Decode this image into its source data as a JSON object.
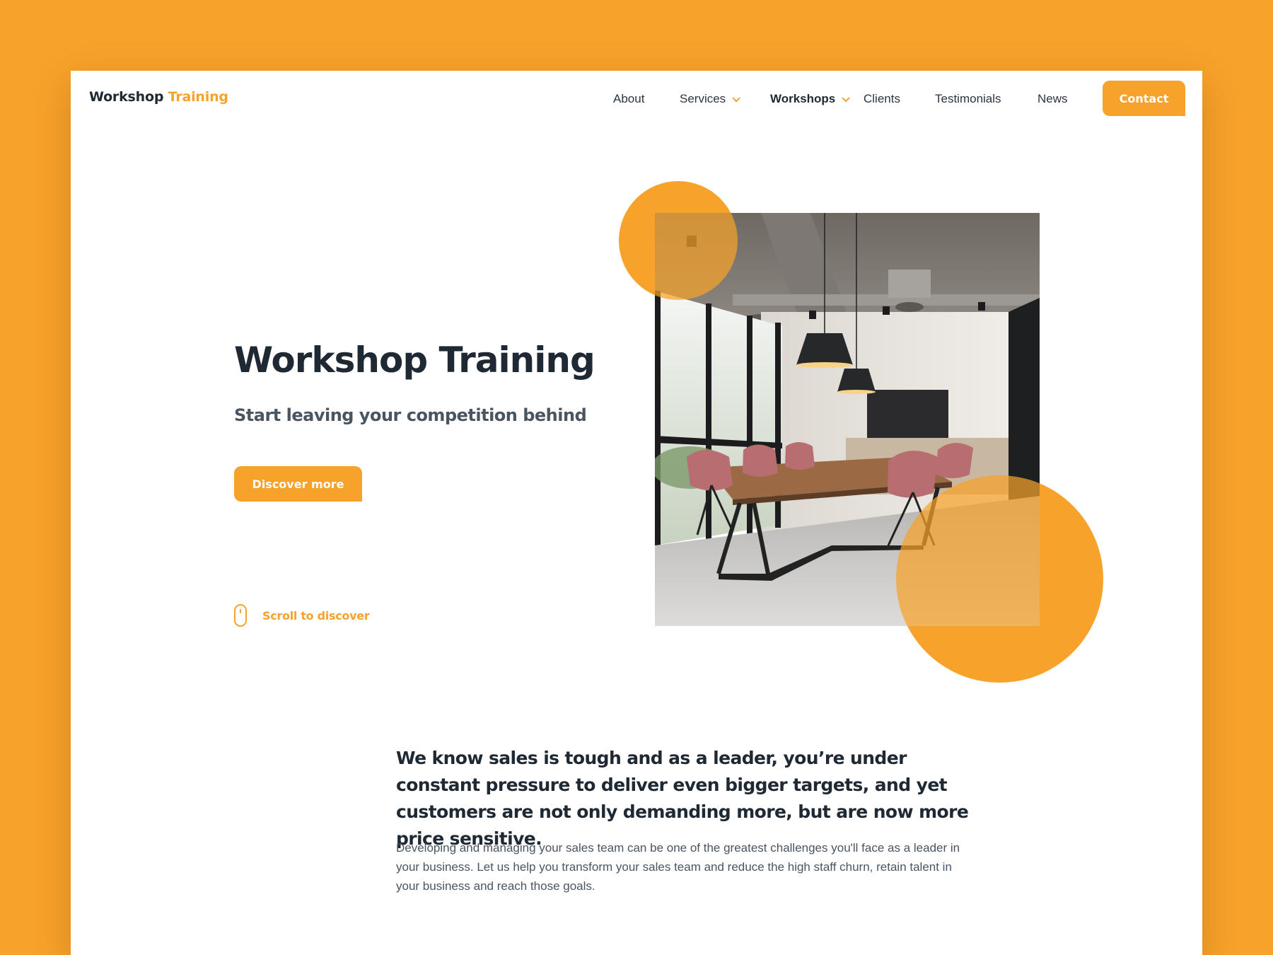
{
  "brand": {
    "name_primary": "Workshop",
    "name_accent": "Training"
  },
  "nav": {
    "items": [
      {
        "label": "About"
      },
      {
        "label": "Services"
      },
      {
        "label": "Workshops"
      },
      {
        "label": "Clients"
      },
      {
        "label": "Testimonials"
      },
      {
        "label": "News"
      }
    ],
    "active": "Workshops",
    "contact_label": "Contact"
  },
  "hero": {
    "title": "Workshop Training",
    "subtitle": "Start leaving your competition behind",
    "cta_label": "Discover more",
    "scroll_label": "Scroll to discover"
  },
  "intro": {
    "heading": "We know sales is tough and as a leader, you’re under constant pressure to deliver even bigger targets, and yet customers are not only demanding more, but are now more price sensitive.",
    "body": "Developing and managing your sales team can be one of the greatest challenges you'll face as a leader in your business. Let us help you transform your sales team and reduce the high staff churn, retain talent in your business and reach those goals."
  },
  "colors": {
    "accent": "#F7A22A",
    "heading": "#1f2933",
    "text": "#4a5562",
    "background": "#ffffff"
  },
  "icons": {
    "dropdown": "chevron-down-icon",
    "scroll": "mouse-icon"
  }
}
